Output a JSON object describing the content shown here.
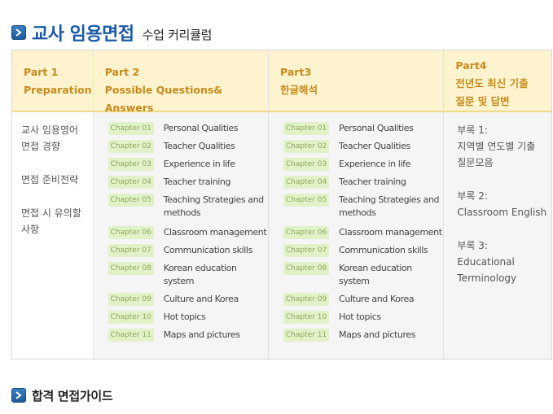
{
  "header": {
    "title_main": "교사 임용면접",
    "title_sub": "수업 커리큘럼"
  },
  "columns": {
    "part1": {
      "head": [
        "Part 1",
        "Preparation"
      ],
      "items": [
        [
          "교사 임용영어",
          "면접 경향"
        ],
        [
          "면접 준비전략"
        ],
        [
          "면접 시 유의할",
          "사항"
        ]
      ]
    },
    "part2": {
      "head": [
        "Part 2",
        "Possible Questions& Answers"
      ]
    },
    "part3": {
      "head": [
        "Part3",
        "한글해석"
      ]
    },
    "part4": {
      "head": [
        "Part4",
        "전년도 최신 기출",
        "질문 및 답변"
      ],
      "items": [
        [
          "부록 1:",
          "지역별 연도별 기출",
          "질문모음"
        ],
        [
          "부록 2:",
          "Classroom English"
        ],
        [
          "부록 3:",
          "Educational",
          "Terminology"
        ]
      ]
    }
  },
  "chapters": [
    {
      "badge": "Chapter 01",
      "title": "Personal Qualities"
    },
    {
      "badge": "Chapter 02",
      "title": "Teacher Qualities"
    },
    {
      "badge": "Chapter 03",
      "title": "Experience in life"
    },
    {
      "badge": "Chapter 04",
      "title": "Teacher training"
    },
    {
      "badge": "Chapter 05",
      "title": "Teaching Strategies and methods"
    },
    {
      "badge": "Chapter 06",
      "title": "Classroom management"
    },
    {
      "badge": "Chapter 07",
      "title": "Communication skills"
    },
    {
      "badge": "Chapter 08",
      "title": "Korean education system"
    },
    {
      "badge": "Chapter 09",
      "title": "Culture and Korea"
    },
    {
      "badge": "Chapter 10",
      "title": "Hot topics"
    },
    {
      "badge": "Chapter 11",
      "title": "Maps and pictures"
    }
  ],
  "footer": {
    "title": "합격 면접가이드"
  },
  "icons": {
    "bullet": "arrow-bullet-icon"
  },
  "colors": {
    "accent": "#1c5aa5",
    "header_text": "#c9891a",
    "header_bg": "#fdf4cf",
    "badge_bg": "#e3f1c9"
  }
}
